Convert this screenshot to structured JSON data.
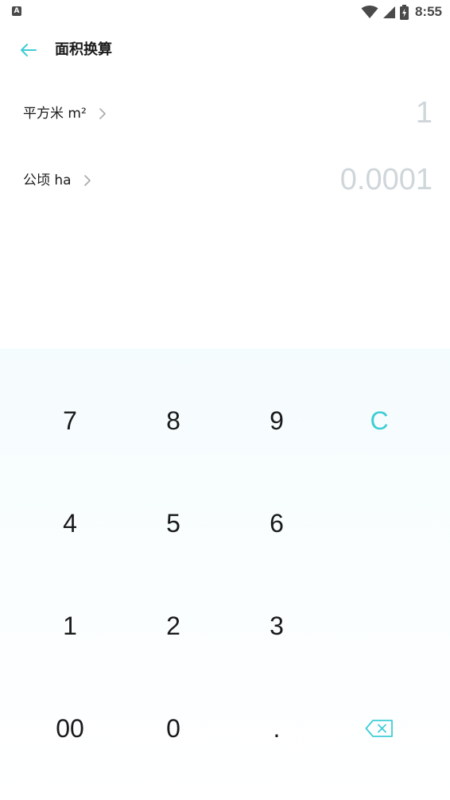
{
  "status_bar": {
    "app_icon_letter": "A",
    "time": "8:55"
  },
  "header": {
    "title": "面积换算"
  },
  "conversions": [
    {
      "unit": "平方米 m²",
      "value": "1"
    },
    {
      "unit": "公顷 ha",
      "value": "0.0001"
    }
  ],
  "keypad": {
    "rows": [
      [
        "7",
        "8",
        "9",
        "C"
      ],
      [
        "4",
        "5",
        "6",
        ""
      ],
      [
        "1",
        "2",
        "3",
        ""
      ],
      [
        "00",
        "0",
        ".",
        ""
      ]
    ],
    "backspace_icon": "backspace-icon"
  },
  "colors": {
    "accent": "#3ecdd6",
    "value_text": "#cfd6da",
    "keypad_bg": "#f5fcfd"
  }
}
